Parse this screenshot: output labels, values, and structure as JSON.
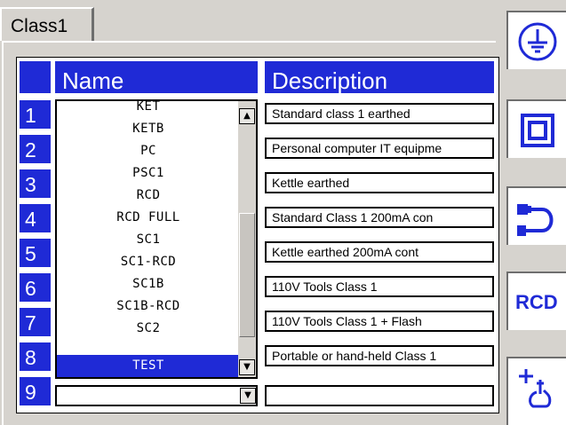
{
  "tab": {
    "label": "Class1"
  },
  "headers": {
    "name": "Name",
    "description": "Description"
  },
  "row_numbers": [
    "1",
    "2",
    "3",
    "4",
    "5",
    "6",
    "7",
    "8",
    "9"
  ],
  "descriptions": [
    "Standard class 1 earthed",
    "Personal computer IT equipme",
    "Kettle earthed",
    "Standard Class 1 200mA con",
    "Kettle earthed 200mA cont",
    "110V Tools Class 1",
    "110V Tools Class 1 + Flash",
    "Portable or hand-held Class 1",
    ""
  ],
  "name_list": {
    "options": [
      "KET",
      "KETB",
      "PC",
      "PSC1",
      "RCD",
      "RCD FULL",
      "SC1",
      "SC1-RCD",
      "SC1B",
      "SC1B-RCD",
      "SC2",
      "TEST"
    ],
    "selected": "TEST"
  },
  "side_buttons": [
    {
      "name": "earth-symbol"
    },
    {
      "name": "double-insulation-square"
    },
    {
      "name": "extension-lead-plug"
    },
    {
      "name": "rcd",
      "label": "RCD"
    },
    {
      "name": "add-handheld-appliance"
    }
  ],
  "colors": {
    "accent": "#1f2ad6",
    "background": "#d6d3ce"
  }
}
